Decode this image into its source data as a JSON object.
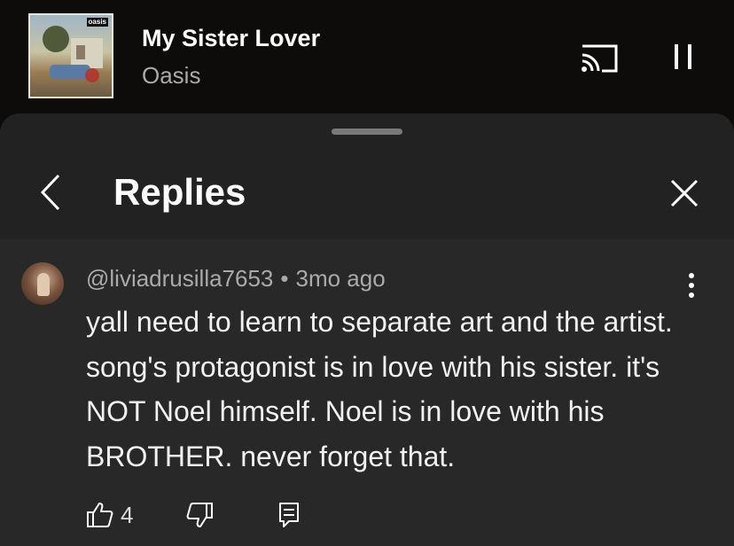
{
  "player": {
    "song_title": "My Sister Lover",
    "artist": "Oasis",
    "album_logo_text": "oasis",
    "cast_icon": "cast-icon",
    "pause_icon": "pause-icon"
  },
  "sheet": {
    "title": "Replies",
    "back_icon": "chevron-left-icon",
    "close_icon": "close-icon"
  },
  "comment": {
    "author": "@liviadrusilla7653",
    "separator": "•",
    "time": "3mo ago",
    "text": "yall need to learn to separate art and the artist. song's protagonist is in love with his sister. it's NOT Noel himself. Noel is in love with his BROTHER. never forget that.",
    "like_count": "4",
    "like_icon": "thumbs-up-icon",
    "dislike_icon": "thumbs-down-icon",
    "reply_icon": "reply-icon",
    "more_icon": "more-vertical-icon"
  },
  "colors": {
    "background": "#0d0c0a",
    "sheet": "#282828",
    "sheet_header": "#222222",
    "secondary_text": "#aaaaaa"
  }
}
